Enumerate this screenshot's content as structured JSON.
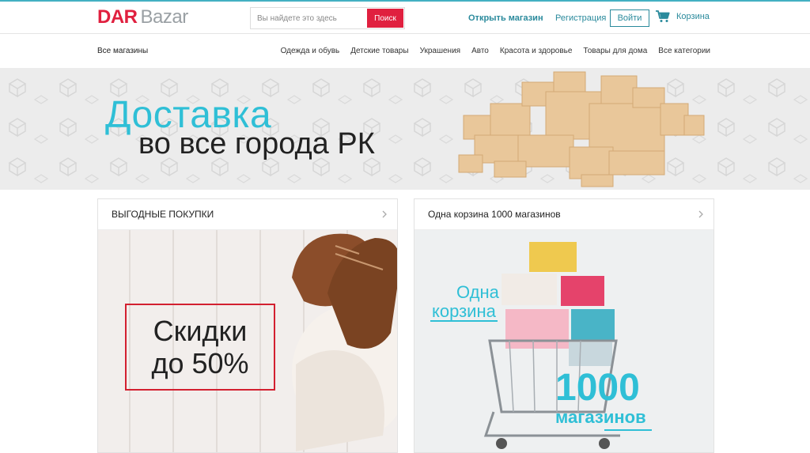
{
  "header": {
    "logo_dar": "DAR",
    "logo_bazar": "Bazar",
    "search_placeholder": "Вы найдете это здесь",
    "search_button": "Поиск",
    "open_shop": "Открыть магазин",
    "register": "Регистрация",
    "login": "Войти",
    "cart": "Корзина"
  },
  "nav": {
    "all_shops": "Все магазины",
    "categories": [
      "Одежда и обувь",
      "Детские товары",
      "Украшения",
      "Авто",
      "Красота и здоровье",
      "Товары для дома",
      "Все категории"
    ]
  },
  "banner": {
    "title": "Доставка",
    "subtitle": "во все города РК"
  },
  "cards": {
    "deals": {
      "title": "ВЫГОДНЫЕ ПОКУПКИ",
      "promo_line1": "Скидки",
      "promo_line2": "до 50%"
    },
    "cart": {
      "title": "Одна корзина 1000 магазинов",
      "promo_line1": "Одна",
      "promo_line2": "корзина",
      "promo_line3": "1000",
      "promo_line4": "магазинов"
    }
  },
  "colors": {
    "brand_red": "#e0203f",
    "accent_teal": "#2a8a9c",
    "banner_cyan": "#2fbfd6"
  }
}
